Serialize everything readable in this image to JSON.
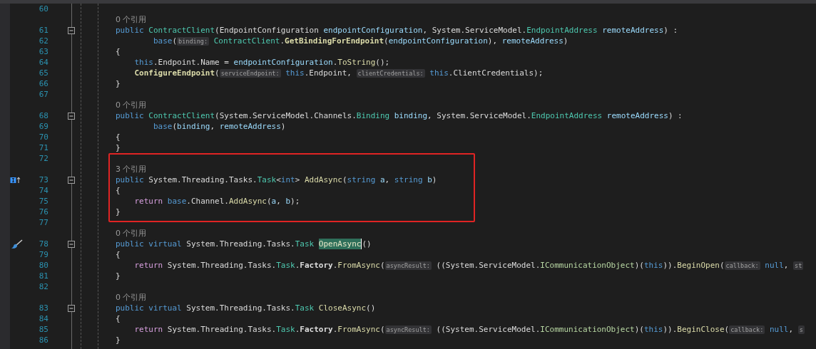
{
  "editor": {
    "rows": [
      {
        "kind": "code",
        "number": "60",
        "tokens": []
      },
      {
        "kind": "codelens",
        "text": "0 个引用"
      },
      {
        "kind": "code",
        "number": "61",
        "fold_expanded": true,
        "tokens": [
          {
            "kind": "kw",
            "text": "public "
          },
          {
            "kind": "type",
            "text": "ContractClient"
          },
          {
            "kind": "plain",
            "text": "(EndpointConfiguration "
          },
          {
            "kind": "param",
            "text": "endpointConfiguration"
          },
          {
            "kind": "plain",
            "text": ", System.ServiceModel."
          },
          {
            "kind": "type",
            "text": "EndpointAddress "
          },
          {
            "kind": "param",
            "text": "remoteAddress"
          },
          {
            "kind": "plain",
            "text": ") :"
          }
        ]
      },
      {
        "kind": "code",
        "number": "62",
        "tokens": [
          {
            "kind": "kw",
            "text": "        base"
          },
          {
            "kind": "plain",
            "text": "("
          },
          {
            "kind": "hint",
            "text": "binding:"
          },
          {
            "kind": "type",
            "text": " ContractClient"
          },
          {
            "kind": "plain",
            "text": "."
          },
          {
            "kind": "method_bold",
            "text": "GetBindingForEndpoint"
          },
          {
            "kind": "plain",
            "text": "("
          },
          {
            "kind": "param",
            "text": "endpointConfiguration"
          },
          {
            "kind": "plain",
            "text": "), "
          },
          {
            "kind": "param",
            "text": "remoteAddress"
          },
          {
            "kind": "plain",
            "text": ")"
          }
        ]
      },
      {
        "kind": "code",
        "number": "63",
        "tokens": [
          {
            "kind": "plain",
            "text": "{"
          }
        ]
      },
      {
        "kind": "code",
        "number": "64",
        "tokens": [
          {
            "kind": "kw",
            "text": "    this"
          },
          {
            "kind": "plain",
            "text": ".Endpoint.Name = "
          },
          {
            "kind": "param",
            "text": "endpointConfiguration"
          },
          {
            "kind": "plain",
            "text": "."
          },
          {
            "kind": "method",
            "text": "ToString"
          },
          {
            "kind": "plain",
            "text": "();"
          }
        ]
      },
      {
        "kind": "code",
        "number": "65",
        "tokens": [
          {
            "kind": "method_bold",
            "text": "    ConfigureEndpoint"
          },
          {
            "kind": "plain",
            "text": "("
          },
          {
            "kind": "hint",
            "text": "serviceEndpoint:"
          },
          {
            "kind": "kw",
            "text": " this"
          },
          {
            "kind": "plain",
            "text": ".Endpoint, "
          },
          {
            "kind": "hint",
            "text": "clientCredentials:"
          },
          {
            "kind": "kw",
            "text": " this"
          },
          {
            "kind": "plain",
            "text": ".ClientCredentials);"
          }
        ]
      },
      {
        "kind": "code",
        "number": "66",
        "tokens": [
          {
            "kind": "plain",
            "text": "}"
          }
        ]
      },
      {
        "kind": "code",
        "number": "67",
        "tokens": []
      },
      {
        "kind": "codelens",
        "text": "0 个引用"
      },
      {
        "kind": "code",
        "number": "68",
        "fold_expanded": true,
        "tokens": [
          {
            "kind": "kw",
            "text": "public "
          },
          {
            "kind": "type",
            "text": "ContractClient"
          },
          {
            "kind": "plain",
            "text": "(System.ServiceModel.Channels."
          },
          {
            "kind": "type",
            "text": "Binding "
          },
          {
            "kind": "param",
            "text": "binding"
          },
          {
            "kind": "plain",
            "text": ", System.ServiceModel."
          },
          {
            "kind": "type",
            "text": "EndpointAddress "
          },
          {
            "kind": "param",
            "text": "remoteAddress"
          },
          {
            "kind": "plain",
            "text": ") :"
          }
        ]
      },
      {
        "kind": "code",
        "number": "69",
        "tokens": [
          {
            "kind": "kw",
            "text": "        base"
          },
          {
            "kind": "plain",
            "text": "("
          },
          {
            "kind": "param",
            "text": "binding"
          },
          {
            "kind": "plain",
            "text": ", "
          },
          {
            "kind": "param",
            "text": "remoteAddress"
          },
          {
            "kind": "plain",
            "text": ")"
          }
        ]
      },
      {
        "kind": "code",
        "number": "70",
        "tokens": [
          {
            "kind": "plain",
            "text": "{"
          }
        ]
      },
      {
        "kind": "code",
        "number": "71",
        "tokens": [
          {
            "kind": "plain",
            "text": "}"
          }
        ]
      },
      {
        "kind": "code",
        "number": "72",
        "boxed": true,
        "tokens": []
      },
      {
        "kind": "codelens",
        "boxed": true,
        "text": "3 个引用"
      },
      {
        "kind": "code",
        "number": "73",
        "boxed": true,
        "fold_expanded": true,
        "gutter_icon": {
          "kind": "implements"
        },
        "tokens": [
          {
            "kind": "kw",
            "text": "public"
          },
          {
            "kind": "plain",
            "text": " System.Threading.Tasks."
          },
          {
            "kind": "type",
            "text": "Task"
          },
          {
            "kind": "plain",
            "text": "<"
          },
          {
            "kind": "kw",
            "text": "int"
          },
          {
            "kind": "plain",
            "text": "> "
          },
          {
            "kind": "method",
            "text": "AddAsync"
          },
          {
            "kind": "plain",
            "text": "("
          },
          {
            "kind": "kw",
            "text": "string "
          },
          {
            "kind": "param",
            "text": "a"
          },
          {
            "kind": "plain",
            "text": ", "
          },
          {
            "kind": "kw",
            "text": "string "
          },
          {
            "kind": "param",
            "text": "b"
          },
          {
            "kind": "plain",
            "text": ")"
          }
        ]
      },
      {
        "kind": "code",
        "number": "74",
        "boxed": true,
        "tokens": [
          {
            "kind": "plain",
            "text": "{"
          }
        ]
      },
      {
        "kind": "code",
        "number": "75",
        "boxed": true,
        "tokens": [
          {
            "kind": "ctrl",
            "text": "    return "
          },
          {
            "kind": "kw",
            "text": "base"
          },
          {
            "kind": "plain",
            "text": ".Channel."
          },
          {
            "kind": "method",
            "text": "AddAsync"
          },
          {
            "kind": "plain",
            "text": "("
          },
          {
            "kind": "param",
            "text": "a"
          },
          {
            "kind": "plain",
            "text": ", "
          },
          {
            "kind": "param",
            "text": "b"
          },
          {
            "kind": "plain",
            "text": ");"
          }
        ]
      },
      {
        "kind": "code",
        "number": "76",
        "boxed": true,
        "tokens": [
          {
            "kind": "plain",
            "text": "}"
          }
        ]
      },
      {
        "kind": "code",
        "number": "77",
        "tokens": []
      },
      {
        "kind": "codelens",
        "text": "0 个引用"
      },
      {
        "kind": "code",
        "number": "78",
        "fold_expanded": true,
        "gutter_icon": {
          "kind": "quick-actions"
        },
        "tokens": [
          {
            "kind": "kw",
            "text": "public virtual"
          },
          {
            "kind": "plain",
            "text": " System.Threading.Tasks."
          },
          {
            "kind": "type",
            "text": "Task "
          },
          {
            "kind": "method",
            "text": "OpenAsync",
            "highlighted": true
          },
          {
            "kind": "plain",
            "text": "()"
          }
        ]
      },
      {
        "kind": "code",
        "number": "79",
        "tokens": [
          {
            "kind": "plain",
            "text": "{"
          }
        ]
      },
      {
        "kind": "code",
        "number": "80",
        "tokens": [
          {
            "kind": "ctrl",
            "text": "    return"
          },
          {
            "kind": "plain",
            "text": " System.Threading.Tasks."
          },
          {
            "kind": "type",
            "text": "Task"
          },
          {
            "kind": "plain",
            "text": "."
          },
          {
            "kind": "bold",
            "text": "Factory"
          },
          {
            "kind": "plain",
            "text": "."
          },
          {
            "kind": "method",
            "text": "FromAsync"
          },
          {
            "kind": "plain",
            "text": "("
          },
          {
            "kind": "hint",
            "text": "asyncResult:"
          },
          {
            "kind": "plain",
            "text": " ((System.ServiceModel."
          },
          {
            "kind": "iface",
            "text": "ICommunicationObject"
          },
          {
            "kind": "plain",
            "text": ")("
          },
          {
            "kind": "kw",
            "text": "this"
          },
          {
            "kind": "plain",
            "text": "))."
          },
          {
            "kind": "method",
            "text": "BeginOpen"
          },
          {
            "kind": "plain",
            "text": "("
          },
          {
            "kind": "hint",
            "text": "callback:"
          },
          {
            "kind": "kw",
            "text": " null"
          },
          {
            "kind": "plain",
            "text": ", "
          },
          {
            "kind": "hint",
            "text": "st"
          }
        ]
      },
      {
        "kind": "code",
        "number": "81",
        "tokens": [
          {
            "kind": "plain",
            "text": "}"
          }
        ]
      },
      {
        "kind": "code",
        "number": "82",
        "tokens": []
      },
      {
        "kind": "codelens",
        "text": "0 个引用"
      },
      {
        "kind": "code",
        "number": "83",
        "fold_expanded": true,
        "tokens": [
          {
            "kind": "kw",
            "text": "public virtual"
          },
          {
            "kind": "plain",
            "text": " System.Threading.Tasks."
          },
          {
            "kind": "type",
            "text": "Task "
          },
          {
            "kind": "method",
            "text": "CloseAsync"
          },
          {
            "kind": "plain",
            "text": "()"
          }
        ]
      },
      {
        "kind": "code",
        "number": "84",
        "tokens": [
          {
            "kind": "plain",
            "text": "{"
          }
        ]
      },
      {
        "kind": "code",
        "number": "85",
        "tokens": [
          {
            "kind": "ctrl",
            "text": "    return"
          },
          {
            "kind": "plain",
            "text": " System.Threading.Tasks."
          },
          {
            "kind": "type",
            "text": "Task"
          },
          {
            "kind": "plain",
            "text": "."
          },
          {
            "kind": "bold",
            "text": "Factory"
          },
          {
            "kind": "plain",
            "text": "."
          },
          {
            "kind": "method",
            "text": "FromAsync"
          },
          {
            "kind": "plain",
            "text": "("
          },
          {
            "kind": "hint",
            "text": "asyncResult:"
          },
          {
            "kind": "plain",
            "text": " ((System.ServiceModel."
          },
          {
            "kind": "iface",
            "text": "ICommunicationObject"
          },
          {
            "kind": "plain",
            "text": ")("
          },
          {
            "kind": "kw",
            "text": "this"
          },
          {
            "kind": "plain",
            "text": "))."
          },
          {
            "kind": "method",
            "text": "BeginClose"
          },
          {
            "kind": "plain",
            "text": "("
          },
          {
            "kind": "hint",
            "text": "callback:"
          },
          {
            "kind": "kw",
            "text": " null"
          },
          {
            "kind": "plain",
            "text": ", "
          },
          {
            "kind": "hint",
            "text": "s"
          }
        ]
      },
      {
        "kind": "code",
        "number": "86",
        "tokens": [
          {
            "kind": "plain",
            "text": "}"
          }
        ]
      }
    ]
  }
}
